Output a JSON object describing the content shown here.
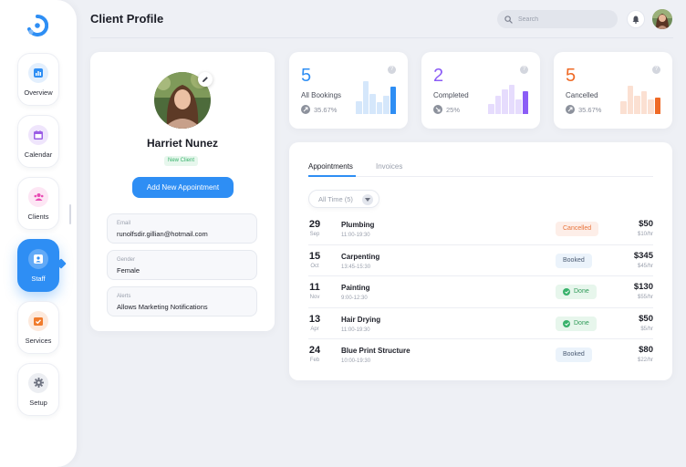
{
  "header": {
    "title": "Client Profile",
    "search_placeholder": "Search"
  },
  "sidebar": {
    "items": [
      {
        "label": "Overview",
        "icon": "bar-chart-icon",
        "color": "#2e8ef4"
      },
      {
        "label": "Calendar",
        "icon": "calendar-icon",
        "color": "#9b5de5"
      },
      {
        "label": "Clients",
        "icon": "users-icon",
        "color": "#e84bb4"
      },
      {
        "label": "Staff",
        "icon": "badge-icon",
        "color": "#2e8ef4",
        "active": true
      },
      {
        "label": "Services",
        "icon": "checklist-icon",
        "color": "#f07b2c"
      },
      {
        "label": "Setup",
        "icon": "gear-icon",
        "color": "#6d7280"
      }
    ]
  },
  "profile": {
    "name": "Harriet Nunez",
    "badge": "New Client",
    "button_label": "Add New Appointment",
    "fields": [
      {
        "label": "Email",
        "value": "runolfsdir.gillian@hotmail.com"
      },
      {
        "label": "Gender",
        "value": "Female"
      },
      {
        "label": "Alerts",
        "value": "Allows Marketing Notifications"
      }
    ]
  },
  "stats": [
    {
      "value": "5",
      "label": "All Bookings",
      "trend": "35.67%",
      "trend_direction": "up",
      "color": "#2e8ef4",
      "light_color": "#d5e7fb"
    },
    {
      "value": "2",
      "label": "Completed",
      "trend": "25%",
      "trend_direction": "down",
      "color": "#8b5cf6",
      "light_color": "#e6dcfd"
    },
    {
      "value": "5",
      "label": "Cancelled",
      "trend": "35.67%",
      "trend_direction": "up",
      "color": "#ef6a26",
      "light_color": "#fbe0d2"
    }
  ],
  "appointments": {
    "tabs": [
      "Appointments",
      "Invoices"
    ],
    "active_tab": 0,
    "filter": "All Time (5)",
    "rows": [
      {
        "day": "29",
        "month": "Sep",
        "service": "Plumbing",
        "time": "11:00-19:30",
        "status": "Cancelled",
        "status_type": "cancel",
        "price": "$50",
        "rate": "$10/hr"
      },
      {
        "day": "15",
        "month": "Oct",
        "service": "Carpenting",
        "time": "13:45-15:30",
        "status": "Booked",
        "status_type": "booked",
        "price": "$345",
        "rate": "$45/hr"
      },
      {
        "day": "11",
        "month": "Nov",
        "service": "Painting",
        "time": "9:00-12:30",
        "status": "Done",
        "status_type": "done",
        "price": "$130",
        "rate": "$55/hr"
      },
      {
        "day": "13",
        "month": "Apr",
        "service": "Hair Drying",
        "time": "11:00-19:30",
        "status": "Done",
        "status_type": "done",
        "price": "$50",
        "rate": "$5/hr"
      },
      {
        "day": "24",
        "month": "Feb",
        "service": "Blue Print Structure",
        "time": "10:00-19:30",
        "status": "Booked",
        "status_type": "booked",
        "price": "$80",
        "rate": "$22/hr"
      }
    ]
  }
}
